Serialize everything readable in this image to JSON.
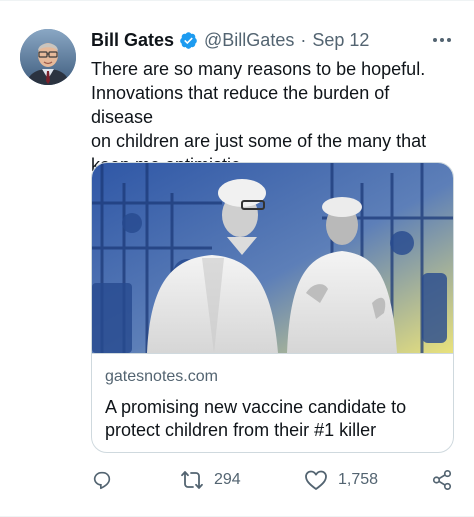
{
  "tweet": {
    "author_name": "Bill Gates",
    "handle": "@BillGates",
    "separator": "·",
    "date": "Sep 12",
    "text": "There are so many reasons to be hopeful.\nInnovations that reduce the burden of disease\non children are just some of the many that\nkeep me optimistic.",
    "card": {
      "domain": "gatesnotes.com",
      "title": "A promising new vaccine candidate to protect children from their #1 killer"
    },
    "actions": {
      "retweet_count": "294",
      "like_count": "1,758"
    }
  },
  "icons": {
    "verified": "verified-badge-icon",
    "more": "more-options-icon",
    "reply": "reply-icon",
    "retweet": "retweet-icon",
    "like": "heart-icon",
    "share": "share-icon"
  },
  "colors": {
    "accent": "#1d9bf0",
    "text_primary": "#0f1419",
    "text_secondary": "#536471",
    "border": "#cfd9de",
    "image_tint_blue": "#3a5ea8",
    "image_tint_yellow": "#e8e27a"
  }
}
